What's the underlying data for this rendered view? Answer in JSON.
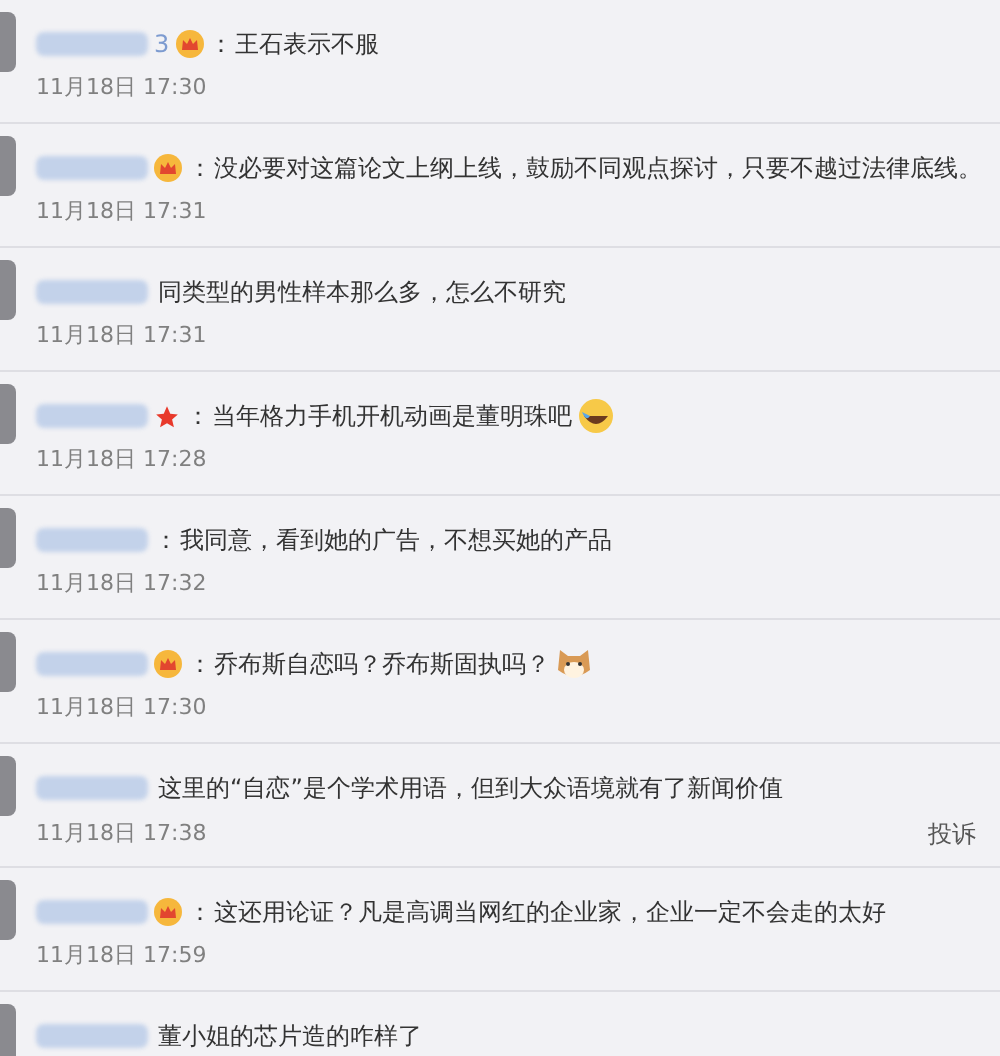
{
  "comments": [
    {
      "name_tail": "3",
      "badge": {
        "kind": "crown"
      },
      "colon": "：",
      "text": "王石表示不服",
      "time": "11月18日 17:30"
    },
    {
      "badge": {
        "kind": "crown"
      },
      "colon": "：",
      "text": "没必要对这篇论文上纲上线，鼓励不同观点探讨，只要不越过法律底线。",
      "time": "11月18日 17:31"
    },
    {
      "text": "同类型的男性样本那么多，怎么不研究",
      "time": "11月18日 17:31"
    },
    {
      "badge": {
        "kind": "star"
      },
      "colon": "：",
      "text": "当年格力手机开机动画是董明珠吧",
      "emoji": {
        "kind": "laugh"
      },
      "time": "11月18日 17:28"
    },
    {
      "colon": "：",
      "text": "我同意，看到她的广告，不想买她的产品",
      "time": "11月18日 17:32"
    },
    {
      "badge": {
        "kind": "crown"
      },
      "colon": "：",
      "text": "乔布斯自恋吗？乔布斯固执吗？",
      "emoji": {
        "kind": "cat"
      },
      "time": "11月18日 17:30"
    },
    {
      "text": "这里的“自恋”是个学术用语，但到大众语境就有了新闻价值",
      "time": "11月18日 17:38",
      "report": "投诉"
    },
    {
      "badge": {
        "kind": "crown"
      },
      "colon": "：",
      "text": "这还用论证？凡是高调当网红的企业家，企业一定不会走的太好",
      "time": "11月18日 17:59"
    },
    {
      "text": "董小姐的芯片造的咋样了"
    }
  ]
}
